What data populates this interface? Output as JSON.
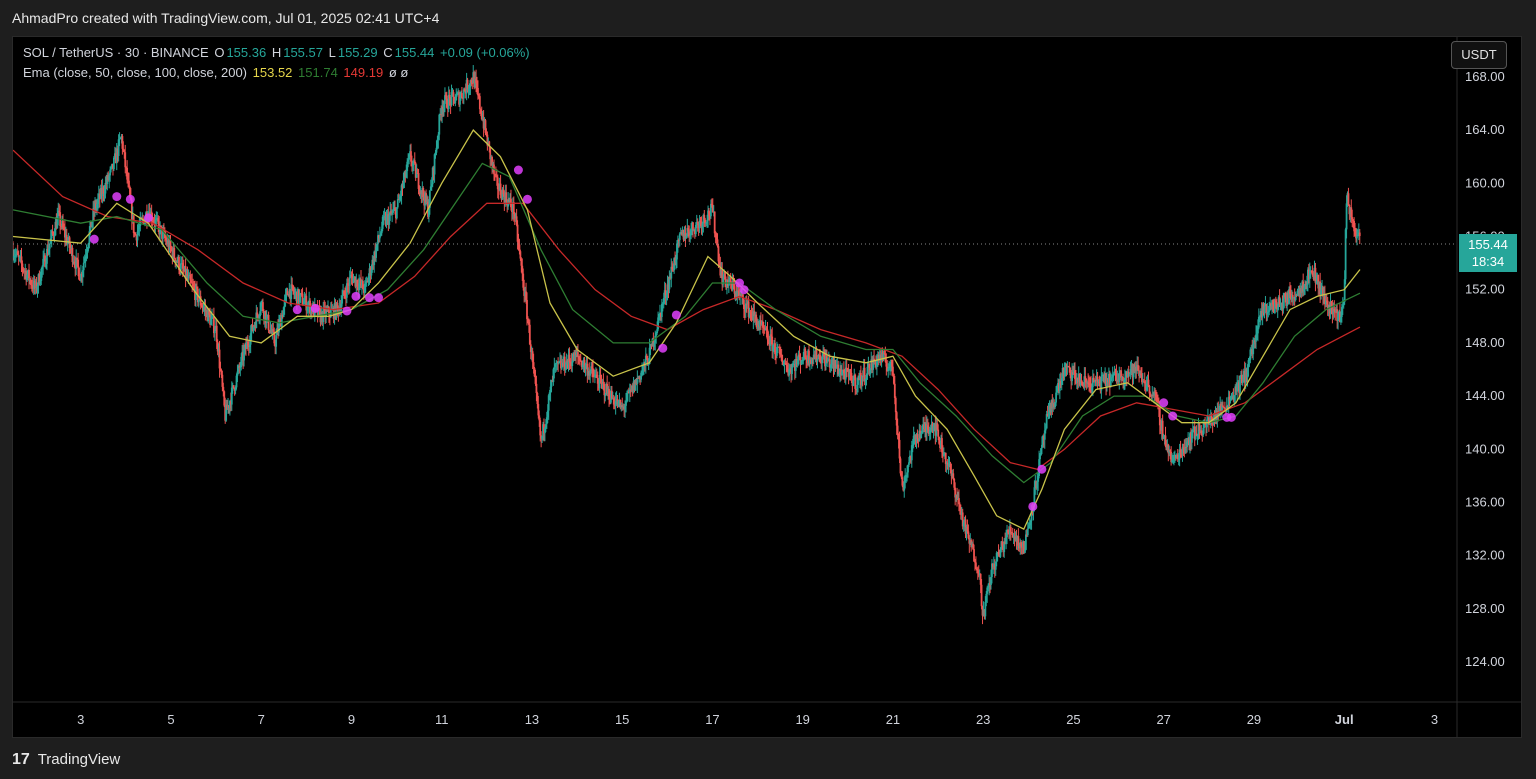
{
  "header": {
    "title": "AhmadPro created with TradingView.com, Jul 01, 2025 02:41 UTC+4"
  },
  "legend": {
    "symbol": "SOL / TetherUS · 30 · BINANCE",
    "o_label": "O",
    "o_value": "155.36",
    "h_label": "H",
    "h_value": "155.57",
    "l_label": "L",
    "l_value": "155.29",
    "c_label": "C",
    "c_value": "155.44",
    "change": "+0.09 (+0.06%)",
    "ema_label": "Ema (close, 50, close, 100, close, 200)",
    "ema_values": [
      "153.52",
      "151.74",
      "149.19"
    ],
    "ema_extra": "ø  ø"
  },
  "currency_button": "USDT",
  "price_tag": {
    "price": "155.44",
    "countdown": "18:34"
  },
  "footer": {
    "brand": "TradingView",
    "logo_icon": "tradingview-logo-icon"
  },
  "colors": {
    "up": "#26a69a",
    "down": "#ef5350",
    "ema50": "#c9c34a",
    "ema100": "#2e7d32",
    "ema200": "#c62828",
    "marker": "#e040fb",
    "price_line": "#888888"
  },
  "chart_data": {
    "type": "candlestick",
    "title": "SOL / TetherUS · 30 · BINANCE",
    "ylim": [
      121,
      171
    ],
    "y_ticks": [
      124,
      128,
      132,
      136,
      140,
      144,
      148,
      152,
      156,
      160,
      164,
      168
    ],
    "y_tick_labels": [
      "124.00",
      "128.00",
      "132.00",
      "136.00",
      "140.00",
      "144.00",
      "148.00",
      "152.00",
      "156.00",
      "160.00",
      "164.00",
      "168.00"
    ],
    "x_range": [
      1.5,
      33.5
    ],
    "x_ticks": [
      3,
      5,
      7,
      9,
      11,
      13,
      15,
      17,
      19,
      21,
      23,
      25,
      27,
      29,
      31,
      33
    ],
    "x_tick_labels": [
      "3",
      "5",
      "7",
      "9",
      "11",
      "13",
      "15",
      "17",
      "19",
      "21",
      "23",
      "25",
      "27",
      "29",
      "Jul",
      "3"
    ],
    "current_price": 155.44,
    "price_path": [
      [
        1.5,
        155
      ],
      [
        2.0,
        152
      ],
      [
        2.5,
        157.5
      ],
      [
        3.0,
        153
      ],
      [
        3.3,
        158
      ],
      [
        3.7,
        161
      ],
      [
        3.9,
        163.5
      ],
      [
        4.2,
        156
      ],
      [
        4.5,
        158
      ],
      [
        5.0,
        155
      ],
      [
        5.5,
        152
      ],
      [
        6.0,
        149
      ],
      [
        6.2,
        142.5
      ],
      [
        6.6,
        147
      ],
      [
        7.0,
        151
      ],
      [
        7.3,
        148
      ],
      [
        7.6,
        152
      ],
      [
        8.0,
        151
      ],
      [
        8.3,
        150
      ],
      [
        8.7,
        150.5
      ],
      [
        9.0,
        153
      ],
      [
        9.3,
        152
      ],
      [
        9.7,
        157
      ],
      [
        10.0,
        158
      ],
      [
        10.3,
        162
      ],
      [
        10.7,
        158
      ],
      [
        11.0,
        166
      ],
      [
        11.4,
        166.5
      ],
      [
        11.7,
        168
      ],
      [
        11.9,
        165
      ],
      [
        12.2,
        160
      ],
      [
        12.6,
        158
      ],
      [
        12.9,
        150
      ],
      [
        13.2,
        140.5
      ],
      [
        13.5,
        146
      ],
      [
        14.0,
        147
      ],
      [
        14.5,
        145
      ],
      [
        15.0,
        143
      ],
      [
        15.3,
        145
      ],
      [
        15.6,
        147
      ],
      [
        15.9,
        151
      ],
      [
        16.3,
        156
      ],
      [
        16.7,
        157
      ],
      [
        17.0,
        158
      ],
      [
        17.2,
        153
      ],
      [
        17.5,
        152
      ],
      [
        17.9,
        150
      ],
      [
        18.3,
        148
      ],
      [
        18.7,
        146
      ],
      [
        19.0,
        147
      ],
      [
        19.4,
        147
      ],
      [
        19.8,
        146
      ],
      [
        20.2,
        145
      ],
      [
        20.7,
        147
      ],
      [
        21.0,
        146
      ],
      [
        21.2,
        137
      ],
      [
        21.5,
        141
      ],
      [
        21.9,
        142
      ],
      [
        22.3,
        138
      ],
      [
        22.6,
        134
      ],
      [
        22.9,
        131
      ],
      [
        23.0,
        127.5
      ],
      [
        23.2,
        131
      ],
      [
        23.6,
        134
      ],
      [
        23.9,
        132.5
      ],
      [
        24.1,
        136
      ],
      [
        24.4,
        142
      ],
      [
        24.8,
        146
      ],
      [
        25.2,
        145
      ],
      [
        25.6,
        145
      ],
      [
        26.0,
        145.5
      ],
      [
        26.4,
        146
      ],
      [
        26.8,
        144
      ],
      [
        27.0,
        141
      ],
      [
        27.2,
        139
      ],
      [
        27.6,
        141
      ],
      [
        28.0,
        142
      ],
      [
        28.4,
        143.5
      ],
      [
        28.8,
        145.5
      ],
      [
        29.2,
        150.5
      ],
      [
        29.6,
        151
      ],
      [
        30.0,
        152
      ],
      [
        30.3,
        153.5
      ],
      [
        30.6,
        151
      ],
      [
        30.9,
        150
      ],
      [
        31.0,
        151
      ],
      [
        31.05,
        159
      ],
      [
        31.2,
        157
      ],
      [
        31.35,
        155.44
      ]
    ],
    "ema50": [
      [
        1.5,
        156
      ],
      [
        3.0,
        155.5
      ],
      [
        3.8,
        158.5
      ],
      [
        4.5,
        157
      ],
      [
        5.5,
        152
      ],
      [
        6.3,
        148.5
      ],
      [
        7.0,
        148
      ],
      [
        7.8,
        150
      ],
      [
        8.5,
        150
      ],
      [
        9.0,
        150.5
      ],
      [
        9.6,
        152.5
      ],
      [
        10.3,
        155.5
      ],
      [
        11.0,
        160
      ],
      [
        11.7,
        164
      ],
      [
        12.3,
        162
      ],
      [
        12.9,
        158
      ],
      [
        13.4,
        151
      ],
      [
        14.0,
        147.5
      ],
      [
        14.8,
        145.5
      ],
      [
        15.6,
        146.5
      ],
      [
        16.2,
        149.5
      ],
      [
        16.9,
        154.5
      ],
      [
        17.4,
        153
      ],
      [
        18.0,
        151
      ],
      [
        18.8,
        148.5
      ],
      [
        19.6,
        147
      ],
      [
        20.4,
        146.5
      ],
      [
        21.0,
        147
      ],
      [
        21.5,
        144
      ],
      [
        22.2,
        141.5
      ],
      [
        22.8,
        138
      ],
      [
        23.3,
        135
      ],
      [
        23.9,
        134
      ],
      [
        24.3,
        137
      ],
      [
        24.8,
        141.5
      ],
      [
        25.5,
        144.5
      ],
      [
        26.2,
        145
      ],
      [
        26.8,
        143.5
      ],
      [
        27.4,
        142
      ],
      [
        28.0,
        142
      ],
      [
        28.6,
        143.5
      ],
      [
        29.2,
        147
      ],
      [
        29.8,
        150.5
      ],
      [
        30.4,
        151.5
      ],
      [
        31.0,
        152
      ],
      [
        31.35,
        153.52
      ]
    ],
    "ema100": [
      [
        1.5,
        158
      ],
      [
        3.0,
        157
      ],
      [
        3.8,
        157.5
      ],
      [
        4.8,
        156.5
      ],
      [
        5.8,
        152.5
      ],
      [
        6.6,
        150
      ],
      [
        7.4,
        149.5
      ],
      [
        8.2,
        150
      ],
      [
        9.0,
        150.5
      ],
      [
        9.8,
        152
      ],
      [
        10.6,
        155
      ],
      [
        11.3,
        158.5
      ],
      [
        11.9,
        161.5
      ],
      [
        12.5,
        160.5
      ],
      [
        13.2,
        155
      ],
      [
        13.9,
        150.5
      ],
      [
        14.8,
        148
      ],
      [
        15.6,
        148
      ],
      [
        16.4,
        150
      ],
      [
        17.0,
        152.5
      ],
      [
        17.6,
        152.5
      ],
      [
        18.4,
        150.5
      ],
      [
        19.4,
        148.5
      ],
      [
        20.4,
        147.5
      ],
      [
        21.0,
        147.5
      ],
      [
        21.6,
        145
      ],
      [
        22.4,
        142.5
      ],
      [
        23.2,
        139.5
      ],
      [
        23.9,
        137.5
      ],
      [
        24.5,
        139
      ],
      [
        25.2,
        142.5
      ],
      [
        25.9,
        144
      ],
      [
        26.6,
        144
      ],
      [
        27.3,
        142.5
      ],
      [
        28.0,
        142
      ],
      [
        28.6,
        142.5
      ],
      [
        29.2,
        145
      ],
      [
        29.9,
        148.5
      ],
      [
        30.6,
        150.5
      ],
      [
        31.35,
        151.74
      ]
    ],
    "ema200": [
      [
        1.5,
        162.5
      ],
      [
        2.6,
        159
      ],
      [
        3.6,
        157.5
      ],
      [
        4.6,
        157
      ],
      [
        5.6,
        155
      ],
      [
        6.6,
        152.5
      ],
      [
        7.6,
        151
      ],
      [
        8.6,
        150.5
      ],
      [
        9.6,
        151
      ],
      [
        10.4,
        153
      ],
      [
        11.2,
        156
      ],
      [
        12.0,
        158.5
      ],
      [
        12.8,
        158.5
      ],
      [
        13.6,
        155
      ],
      [
        14.4,
        152
      ],
      [
        15.2,
        150
      ],
      [
        16.0,
        149
      ],
      [
        16.8,
        150.5
      ],
      [
        17.6,
        151.5
      ],
      [
        18.4,
        150.5
      ],
      [
        19.4,
        149
      ],
      [
        20.4,
        148
      ],
      [
        21.2,
        147
      ],
      [
        22.0,
        144.5
      ],
      [
        22.8,
        141.5
      ],
      [
        23.6,
        139
      ],
      [
        24.2,
        138.5
      ],
      [
        24.8,
        140
      ],
      [
        25.6,
        142.5
      ],
      [
        26.4,
        143.5
      ],
      [
        27.2,
        143
      ],
      [
        28.0,
        142.5
      ],
      [
        28.8,
        143.5
      ],
      [
        29.6,
        145.5
      ],
      [
        30.4,
        147.5
      ],
      [
        31.35,
        149.19
      ]
    ],
    "markers": [
      [
        3.3,
        155.8
      ],
      [
        3.8,
        159
      ],
      [
        4.1,
        158.8
      ],
      [
        4.5,
        157.4
      ],
      [
        7.8,
        150.5
      ],
      [
        8.2,
        150.6
      ],
      [
        8.9,
        150.4
      ],
      [
        9.1,
        151.5
      ],
      [
        9.4,
        151.4
      ],
      [
        9.6,
        151.4
      ],
      [
        12.7,
        161
      ],
      [
        12.9,
        158.8
      ],
      [
        15.9,
        147.6
      ],
      [
        16.2,
        150.1
      ],
      [
        17.6,
        152.5
      ],
      [
        17.7,
        152
      ],
      [
        24.1,
        135.7
      ],
      [
        24.3,
        138.5
      ],
      [
        27.0,
        143.5
      ],
      [
        27.2,
        142.5
      ],
      [
        28.4,
        142.4
      ],
      [
        28.5,
        142.4
      ]
    ]
  }
}
